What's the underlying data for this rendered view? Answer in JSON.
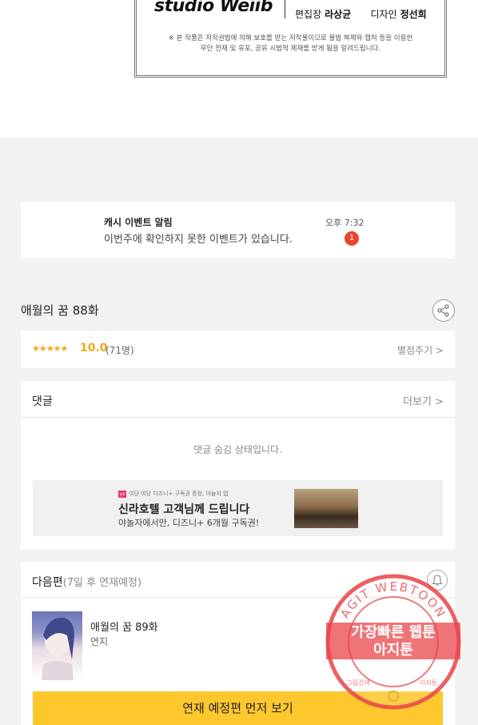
{
  "credits": {
    "logo_text": "studio Weiib",
    "staff": [
      {
        "role": "편집장",
        "name": "라상균"
      },
      {
        "role": "디자인",
        "name": "정선희"
      }
    ],
    "notice_line1": "※ 본 작품은 저작권법에 의해 보호를 받는 저작물이므로 불법 복제와 캡처 등을 이용한",
    "notice_line2": "무단 전재 및 유포, 공유 시법적 제재를 받게 됨을 알려드립니다."
  },
  "event": {
    "title": "캐시 이벤트 알림",
    "message": "이번주에 확인하지 못한 이벤트가 있습니다.",
    "time": "오후 7:32",
    "badge": "1"
  },
  "episode": {
    "title": "애월의 꿈 88화",
    "share_icon": "share-icon"
  },
  "rating": {
    "stars": "★★★★★",
    "score": "10.0",
    "count": "(71명)",
    "rate_link": "별점주기 >"
  },
  "comments": {
    "heading": "댓글",
    "more_link": "더보기 >",
    "hidden_message": "댓글 숨김 상태입니다."
  },
  "ad": {
    "logo": "yo",
    "small_text": "여당 여당 디즈니+ 구독권 증정, 야놀자 앱",
    "title": "신라호텔 고객님께 드립니다",
    "subtitle": "야놀자에서만, 디즈니+ 6개월 구독권!"
  },
  "next": {
    "heading": "다음편",
    "heading_sub": "(7일 후 연재예정)",
    "bell_icon": "bell-icon",
    "ep_title": "애월의 꿈 89화",
    "author": "연지",
    "cta_label": "연재 예정편 먼저 보기"
  },
  "watermark": {
    "ring_text": "AGIT WEBTOON",
    "line1": "가장빠른 웹툰",
    "line2": "아지툰",
    "bottom_left": "그림검색",
    "bottom_right": "아지툰"
  },
  "colors": {
    "accent_yellow": "#fdc72e",
    "star_orange": "#f2a91a",
    "badge_red": "#e8442e",
    "stamp_red": "#e8454a"
  }
}
